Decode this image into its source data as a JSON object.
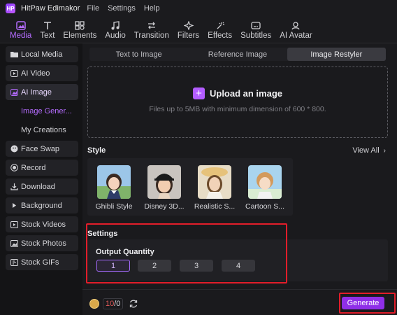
{
  "app": {
    "logo_text": "HP",
    "name": "HitPaw Edimakor",
    "menu": [
      "File",
      "Settings",
      "Help"
    ]
  },
  "toolbar": {
    "tabs": [
      {
        "label": "Media",
        "icon": "media-icon",
        "active": true
      },
      {
        "label": "Text",
        "icon": "text-icon"
      },
      {
        "label": "Elements",
        "icon": "elements-icon"
      },
      {
        "label": "Audio",
        "icon": "audio-icon"
      },
      {
        "label": "Transition",
        "icon": "transition-icon"
      },
      {
        "label": "Filters",
        "icon": "filters-icon"
      },
      {
        "label": "Effects",
        "icon": "effects-icon"
      },
      {
        "label": "Subtitles",
        "icon": "subtitles-icon"
      },
      {
        "label": "AI Avatar",
        "icon": "ai-avatar-icon"
      }
    ]
  },
  "sidebar": {
    "items": [
      {
        "label": "Local Media",
        "icon": "folder-icon"
      },
      {
        "label": "AI Video",
        "icon": "ai-video-icon"
      },
      {
        "label": "AI Image",
        "icon": "ai-image-icon",
        "active": true
      },
      {
        "label": "Image Gener...",
        "sub": true,
        "active": true
      },
      {
        "label": "My Creations",
        "sub": true
      },
      {
        "label": "Face Swap",
        "icon": "face-swap-icon"
      },
      {
        "label": "Record",
        "icon": "record-icon"
      },
      {
        "label": "Download",
        "icon": "download-icon"
      },
      {
        "label": "Background",
        "icon": "background-icon"
      },
      {
        "label": "Stock Videos",
        "icon": "stock-videos-icon"
      },
      {
        "label": "Stock Photos",
        "icon": "stock-photos-icon"
      },
      {
        "label": "Stock GIFs",
        "icon": "stock-gifs-icon"
      }
    ]
  },
  "main": {
    "tabs": [
      {
        "label": "Text to Image"
      },
      {
        "label": "Reference Image"
      },
      {
        "label": "Image Restyler",
        "active": true
      }
    ],
    "upload": {
      "plus": "+",
      "title": "Upload an image",
      "hint": "Files up to 5MB with minimum dimension of 600 * 800."
    },
    "style": {
      "label": "Style",
      "view_all": "View All",
      "view_all_icon": "chevron-right-icon",
      "chevron": "›",
      "options": [
        {
          "name": "Ghibli Style"
        },
        {
          "name": "Disney 3D..."
        },
        {
          "name": "Realistic S..."
        },
        {
          "name": "Cartoon S..."
        }
      ]
    },
    "settings": {
      "label": "Settings",
      "output_quantity_label": "Output Quantity",
      "quantities": [
        "1",
        "2",
        "3",
        "4"
      ],
      "selected_quantity": "1"
    },
    "footer": {
      "credits_used": "10",
      "credits_total": "/0",
      "generate_label": "Generate"
    }
  },
  "colors": {
    "accent": "#b56cff",
    "generate": "#8f2fe8",
    "highlight_box": "#e21d2a"
  }
}
